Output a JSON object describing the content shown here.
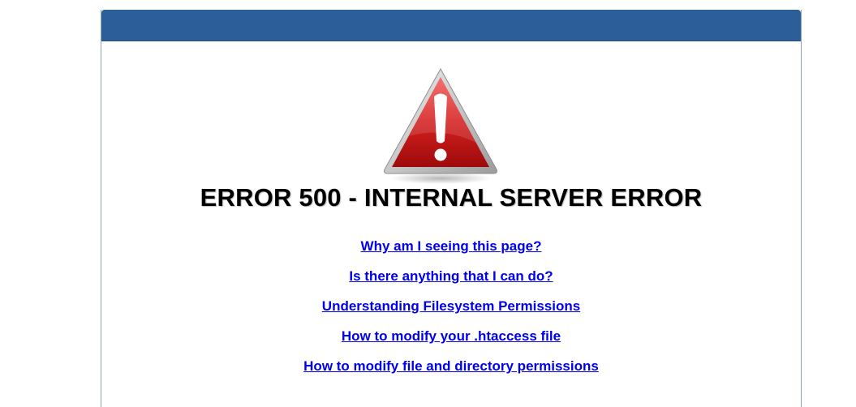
{
  "colors": {
    "header": "#2c5f9a",
    "border": "#8fa4bd",
    "link": "#0000ee",
    "warning_red": "#d51f1f"
  },
  "error": {
    "icon": "warning-triangle-icon",
    "title": "ERROR 500 - INTERNAL SERVER ERROR"
  },
  "links": [
    "Why am I seeing this page?",
    "Is there anything that I can do?",
    "Understanding Filesystem Permissions",
    "How to modify your .htaccess file",
    "How to modify file and directory permissions"
  ]
}
